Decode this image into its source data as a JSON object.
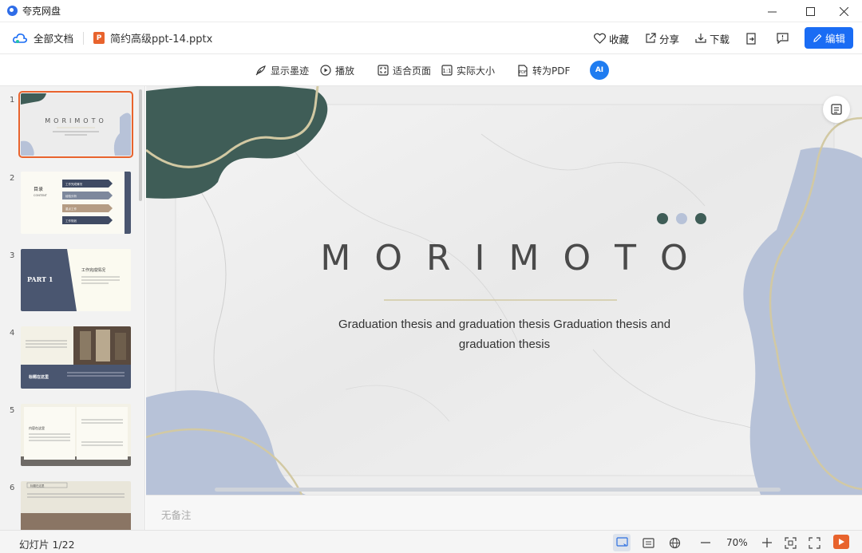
{
  "window": {
    "app_title": "夸克网盘",
    "controls": [
      "—",
      "☐",
      "✕"
    ]
  },
  "docbar": {
    "breadcrumb": "全部文档",
    "filename": "简约高级ppt-14.pptx",
    "file_icon_letter": "P",
    "actions": {
      "favorite": "收藏",
      "share": "分享",
      "download": "下载",
      "edit": "编辑"
    }
  },
  "toolbar": {
    "show_ink": "显示墨迹",
    "play": "播放",
    "fit_page": "适合页面",
    "actual_size": "实际大小",
    "to_pdf": "转为PDF",
    "ai_label": "AI"
  },
  "thumbnails": [
    {
      "num": "1",
      "selected": true,
      "title": "MORIMOTO"
    },
    {
      "num": "2",
      "selected": false,
      "title": "目录",
      "subtitle": "CONTENT",
      "items": [
        "工作完成情况",
        "经验分析",
        "重点工作",
        "工作规划"
      ]
    },
    {
      "num": "3",
      "selected": false,
      "title": "PART 1",
      "subtitle": "工作完成情况"
    },
    {
      "num": "4",
      "selected": false,
      "title": "标题在这里"
    },
    {
      "num": "5",
      "selected": false,
      "title": "内容在这里"
    },
    {
      "num": "6",
      "selected": false,
      "title": "标题在这里"
    }
  ],
  "slide": {
    "title": "MORIMOTO",
    "subtitle": "Graduation thesis and graduation thesis  Graduation thesis and graduation thesis"
  },
  "notes": {
    "placeholder": "无备注"
  },
  "status": {
    "slide_counter": "幻灯片 1/22",
    "zoom": "70%"
  },
  "colors": {
    "accent_blue": "#1a6cf4",
    "ppt_orange": "#e8632d",
    "dark_green": "#3f5d57",
    "periwinkle": "#b7c2d8",
    "gold": "#d2c9a3"
  }
}
